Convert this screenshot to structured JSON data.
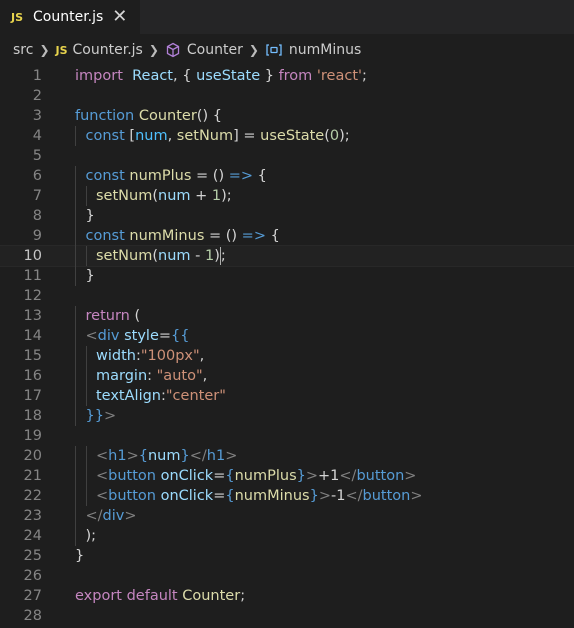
{
  "tab": {
    "badge": "JS",
    "title": "Counter.js",
    "close": "✕"
  },
  "breadcrumb": {
    "folder": "src",
    "file": "Counter.js",
    "component": "Counter",
    "symbol": "numMinus"
  },
  "lines": [
    [
      [
        "kw",
        "import"
      ],
      [
        "",
        "  "
      ],
      [
        "va",
        "React"
      ],
      [
        "",
        ", { "
      ],
      [
        "va",
        "useState"
      ],
      [
        "",
        " } "
      ],
      [
        "kw",
        "from"
      ],
      [
        "",
        " "
      ],
      [
        "str",
        "'react'"
      ],
      [
        "",
        ";"
      ]
    ],
    [],
    [
      [
        "st",
        "function"
      ],
      [
        "",
        " "
      ],
      [
        "fn",
        "Counter"
      ],
      [
        "",
        "() {"
      ]
    ],
    [
      [
        "",
        ""
      ],
      [
        "st",
        "const"
      ],
      [
        "",
        " ["
      ],
      [
        "cn",
        "num"
      ],
      [
        "",
        ", "
      ],
      [
        "fn",
        "setNum"
      ],
      [
        "",
        "] = "
      ],
      [
        "fn",
        "useState"
      ],
      [
        "",
        "("
      ],
      [
        "num",
        "0"
      ],
      [
        "",
        ");"
      ]
    ],
    [],
    [
      [
        "st",
        "const"
      ],
      [
        "",
        " "
      ],
      [
        "fn",
        "numPlus"
      ],
      [
        "",
        " = () "
      ],
      [
        "st",
        "=>"
      ],
      [
        "",
        " {"
      ]
    ],
    [
      [
        "fn",
        "setNum"
      ],
      [
        "",
        "("
      ],
      [
        "va",
        "num"
      ],
      [
        "",
        " + "
      ],
      [
        "num",
        "1"
      ],
      [
        "",
        ");"
      ]
    ],
    [
      [
        "",
        "}"
      ]
    ],
    [
      [
        "st",
        "const"
      ],
      [
        "",
        " "
      ],
      [
        "fn",
        "numMinus"
      ],
      [
        "",
        " = () "
      ],
      [
        "st",
        "=>"
      ],
      [
        "",
        " {"
      ]
    ],
    [
      [
        "fn",
        "setNum"
      ],
      [
        "",
        "("
      ],
      [
        "va",
        "num"
      ],
      [
        "",
        " - "
      ],
      [
        "num",
        "1"
      ],
      [
        "",
        ")"
      ],
      [
        "cursor",
        ""
      ],
      [
        "",
        ";"
      ]
    ],
    [
      [
        "",
        "}"
      ]
    ],
    [],
    [
      [
        "kw",
        "return"
      ],
      [
        "",
        " ("
      ]
    ],
    [
      [
        "tg",
        "<"
      ],
      [
        "st",
        "div"
      ],
      [
        "",
        " "
      ],
      [
        "va",
        "style"
      ],
      [
        "",
        "="
      ],
      [
        "st",
        "{{"
      ]
    ],
    [
      [
        "va",
        "width"
      ],
      [
        "",
        ":"
      ],
      [
        "str",
        "\"100px\""
      ],
      [
        "",
        ","
      ]
    ],
    [
      [
        "va",
        "margin"
      ],
      [
        "",
        ": "
      ],
      [
        "str",
        "\"auto\""
      ],
      [
        "",
        ","
      ]
    ],
    [
      [
        "va",
        "textAlign"
      ],
      [
        "",
        ":"
      ],
      [
        "str",
        "\"center\""
      ]
    ],
    [
      [
        "st",
        "}}"
      ],
      [
        "tg",
        ">"
      ]
    ],
    [],
    [
      [
        "tg",
        "<"
      ],
      [
        "st",
        "h1"
      ],
      [
        "tg",
        ">"
      ],
      [
        "st",
        "{"
      ],
      [
        "va",
        "num"
      ],
      [
        "st",
        "}"
      ],
      [
        "tg",
        "</"
      ],
      [
        "st",
        "h1"
      ],
      [
        "tg",
        ">"
      ]
    ],
    [
      [
        "tg",
        "<"
      ],
      [
        "st",
        "button"
      ],
      [
        "",
        " "
      ],
      [
        "va",
        "onClick"
      ],
      [
        "",
        "="
      ],
      [
        "st",
        "{"
      ],
      [
        "fn",
        "numPlus"
      ],
      [
        "st",
        "}"
      ],
      [
        "tg",
        ">"
      ],
      [
        "",
        "+1"
      ],
      [
        "tg",
        "</"
      ],
      [
        "st",
        "button"
      ],
      [
        "tg",
        ">"
      ]
    ],
    [
      [
        "tg",
        "<"
      ],
      [
        "st",
        "button"
      ],
      [
        "",
        " "
      ],
      [
        "va",
        "onClick"
      ],
      [
        "",
        "="
      ],
      [
        "st",
        "{"
      ],
      [
        "fn",
        "numMinus"
      ],
      [
        "st",
        "}"
      ],
      [
        "tg",
        ">"
      ],
      [
        "",
        "-1"
      ],
      [
        "tg",
        "</"
      ],
      [
        "st",
        "button"
      ],
      [
        "tg",
        ">"
      ]
    ],
    [
      [
        "tg",
        "</"
      ],
      [
        "st",
        "div"
      ],
      [
        "tg",
        ">"
      ]
    ],
    [
      [
        "",
        ");"
      ]
    ],
    [
      [
        "",
        "}"
      ]
    ],
    [],
    [
      [
        "kw",
        "export"
      ],
      [
        "",
        " "
      ],
      [
        "kw",
        "default"
      ],
      [
        "",
        " "
      ],
      [
        "fn",
        "Counter"
      ],
      [
        "",
        ";"
      ]
    ],
    []
  ],
  "indents": [
    0,
    0,
    0,
    1,
    0,
    1,
    2,
    1,
    1,
    2,
    1,
    0,
    1,
    1,
    2,
    2,
    2,
    1,
    0,
    2,
    2,
    2,
    1,
    1,
    0,
    0,
    0,
    0
  ],
  "active_line": 10,
  "colors": {
    "background": "#1e1e1e",
    "tabbar": "#252526",
    "keyword": "#c586c0",
    "storage": "#569cd6",
    "function": "#dcdcaa",
    "variable": "#9cdcfe",
    "string": "#ce9178",
    "number": "#b5cea8"
  }
}
